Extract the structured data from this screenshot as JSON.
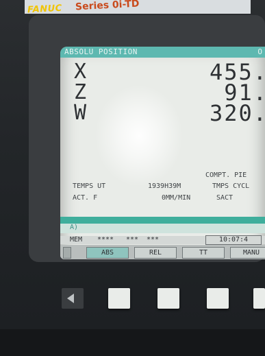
{
  "header": {
    "brand": "FANUC",
    "series": "Series 0i-TD"
  },
  "screen": {
    "title": "ABSOLU POSITION",
    "title_right": "O",
    "axes": [
      {
        "label": "X",
        "value": "455."
      },
      {
        "label": "Z",
        "value": "91."
      },
      {
        "label": "W",
        "value": "320."
      }
    ],
    "compt_label": "COMPT. PIE",
    "temps_label": "TEMPS UT",
    "temps_value": "1939H39M",
    "tmps_cycle_label": "TMPS CYCL",
    "act_f_label": "ACT. F",
    "act_f_value": "0MM/MIN",
    "sact_label": "SACT",
    "input_prompt": "A)",
    "status": {
      "mode": "MEM",
      "s1": "****",
      "s2": "***",
      "s3": "***",
      "clock": "10:07:4"
    },
    "softkeys": [
      "ABS",
      "REL",
      "TT",
      "MANU"
    ]
  },
  "colors": {
    "title_bar": "#5db8b0",
    "screen_bg": "#e9ece8",
    "teal_bar": "#3fae9c",
    "brand": "#f0c400",
    "series": "#c94a1c"
  }
}
